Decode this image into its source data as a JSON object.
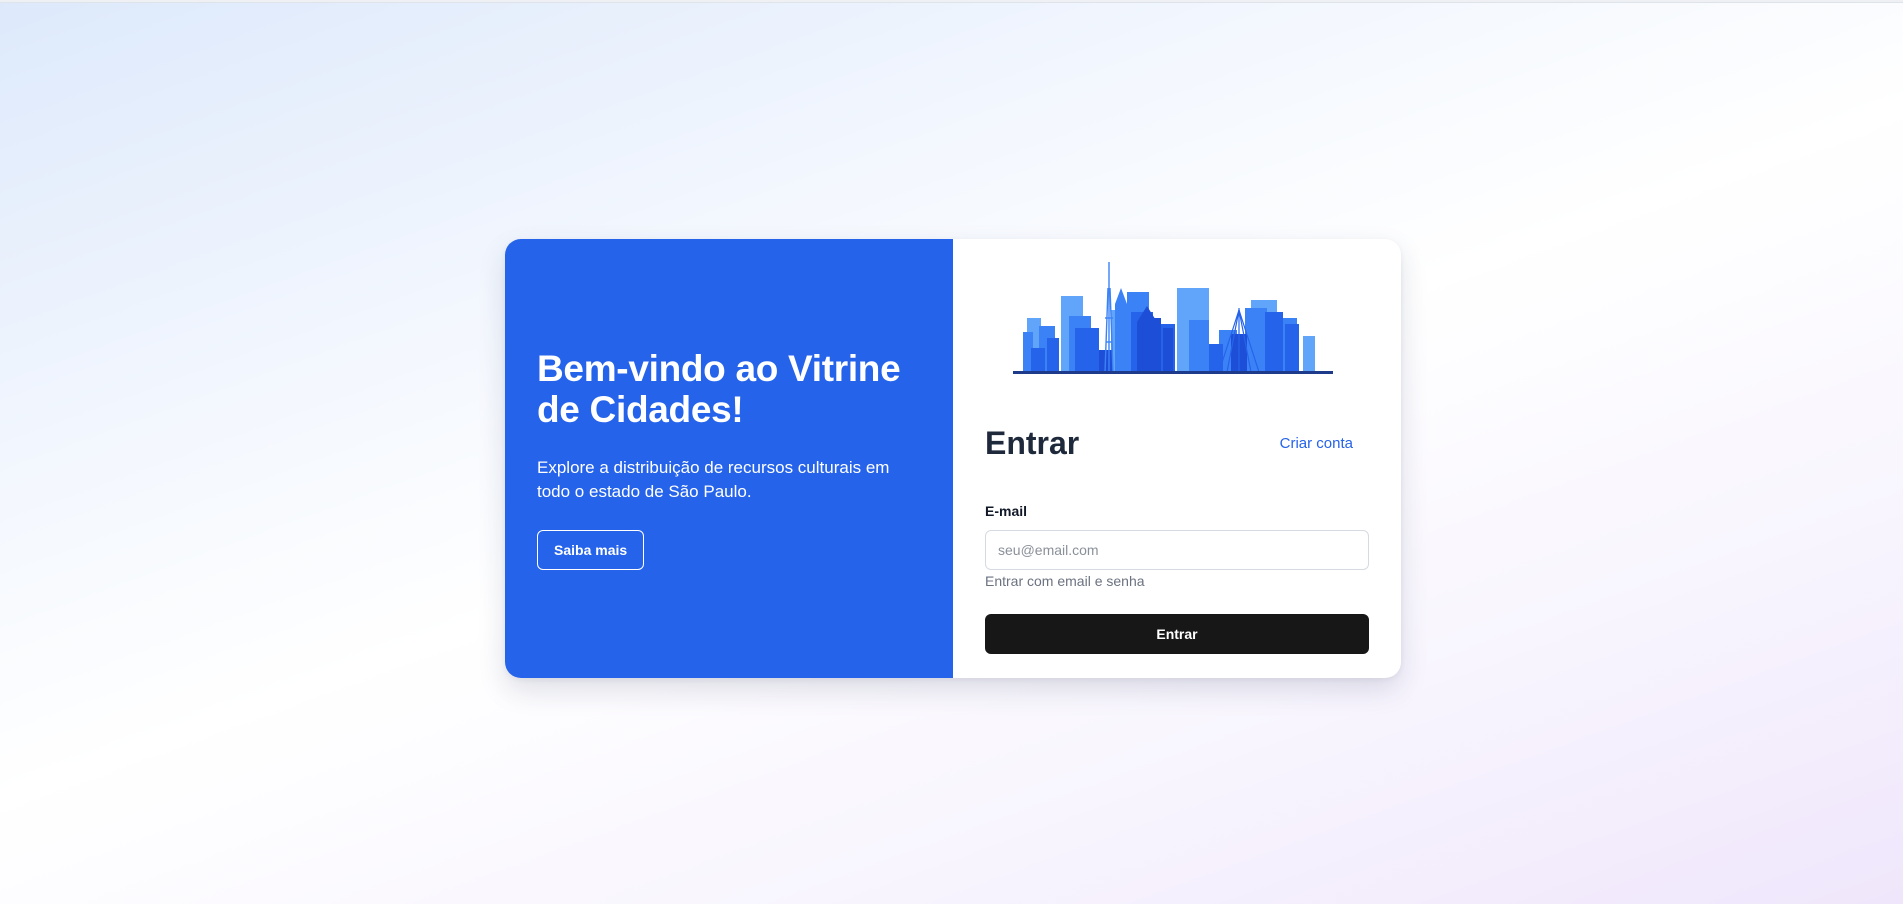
{
  "welcome": {
    "title": "Bem-vindo ao Vitrine de Cidades!",
    "description": "Explore a distribuição de recursos culturais em todo o estado de São Paulo.",
    "learn_more_label": "Saiba mais"
  },
  "login": {
    "title": "Entrar",
    "create_account_label": "Criar conta",
    "email_label": "E-mail",
    "email_placeholder": "seu@email.com",
    "email_value": "",
    "hint": "Entrar com email e senha",
    "submit_label": "Entrar"
  },
  "illustration": {
    "name": "city-skyline",
    "colors": [
      "#1e3a8a",
      "#1d4ed8",
      "#2563eb",
      "#3b82f6",
      "#60a5fa"
    ]
  },
  "colors": {
    "accent": "#2563eb",
    "button_dark": "#171717",
    "heading": "#1e293b"
  }
}
